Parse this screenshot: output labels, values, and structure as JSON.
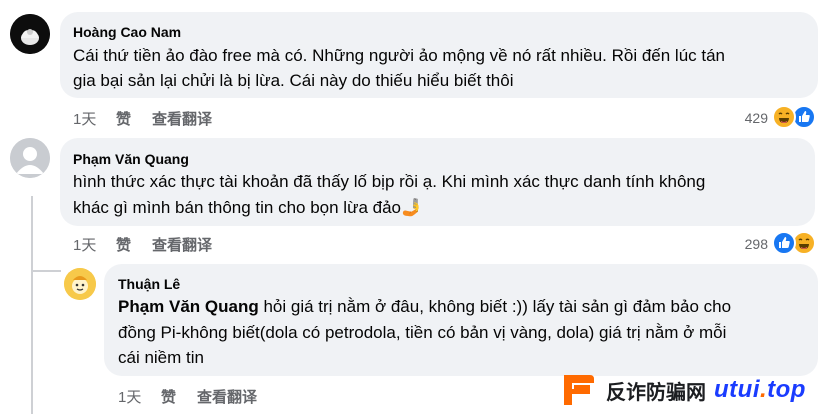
{
  "comments": [
    {
      "author": "Hoàng Cao Nam",
      "line1": "Cái thứ tiền ảo đào free mà có. Những người ảo mộng về nó rất nhiều. Rồi đến lúc tán",
      "line2": "gia bại sản lại chửi là bị lừa. Cái này do thiếu hiểu biết thôi",
      "time": "1天",
      "like": "赞",
      "translate": "查看翻译",
      "reaction_count": "429",
      "reaction_icons": [
        "haha-icon",
        "like-icon"
      ]
    },
    {
      "author": "Phạm Văn Quang",
      "line1": "hình thức xác thực tài khoản đã thấy lố bịp rồi ạ. Khi mình xác thực danh tính không",
      "line2": "khác gì mình bán thông tin cho bọn lừa đảo",
      "emoji": "🤳",
      "time": "1天",
      "like": "赞",
      "translate": "查看翻译",
      "reaction_count": "298",
      "reaction_icons": [
        "like-icon",
        "haha-icon"
      ]
    },
    {
      "author": "Thuận Lê",
      "mention": "Phạm Văn Quang",
      "line1_rest": " hỏi giá trị nằm ở đâu, không biết :)) lấy tài sản gì đảm bảo cho",
      "line2": "đồng Pi-không biết(dola có petrodola, tiền có bản vị vàng, dola) giá trị nằm ở mỗi",
      "line3": "cái niềm tin",
      "time": "1天",
      "like": "赞",
      "translate": "查看翻译"
    }
  ],
  "watermark": {
    "cn_text": "反诈防骗网",
    "url_main": "utui",
    "url_dot": ".",
    "url_tld": "top"
  },
  "colors": {
    "bubble_bg": "#f0f2f5",
    "secondary_text": "#65676b",
    "like_blue": "#1877f2",
    "haha_yellow": "#f7b125",
    "watermark_orange": "#ff6a00"
  }
}
